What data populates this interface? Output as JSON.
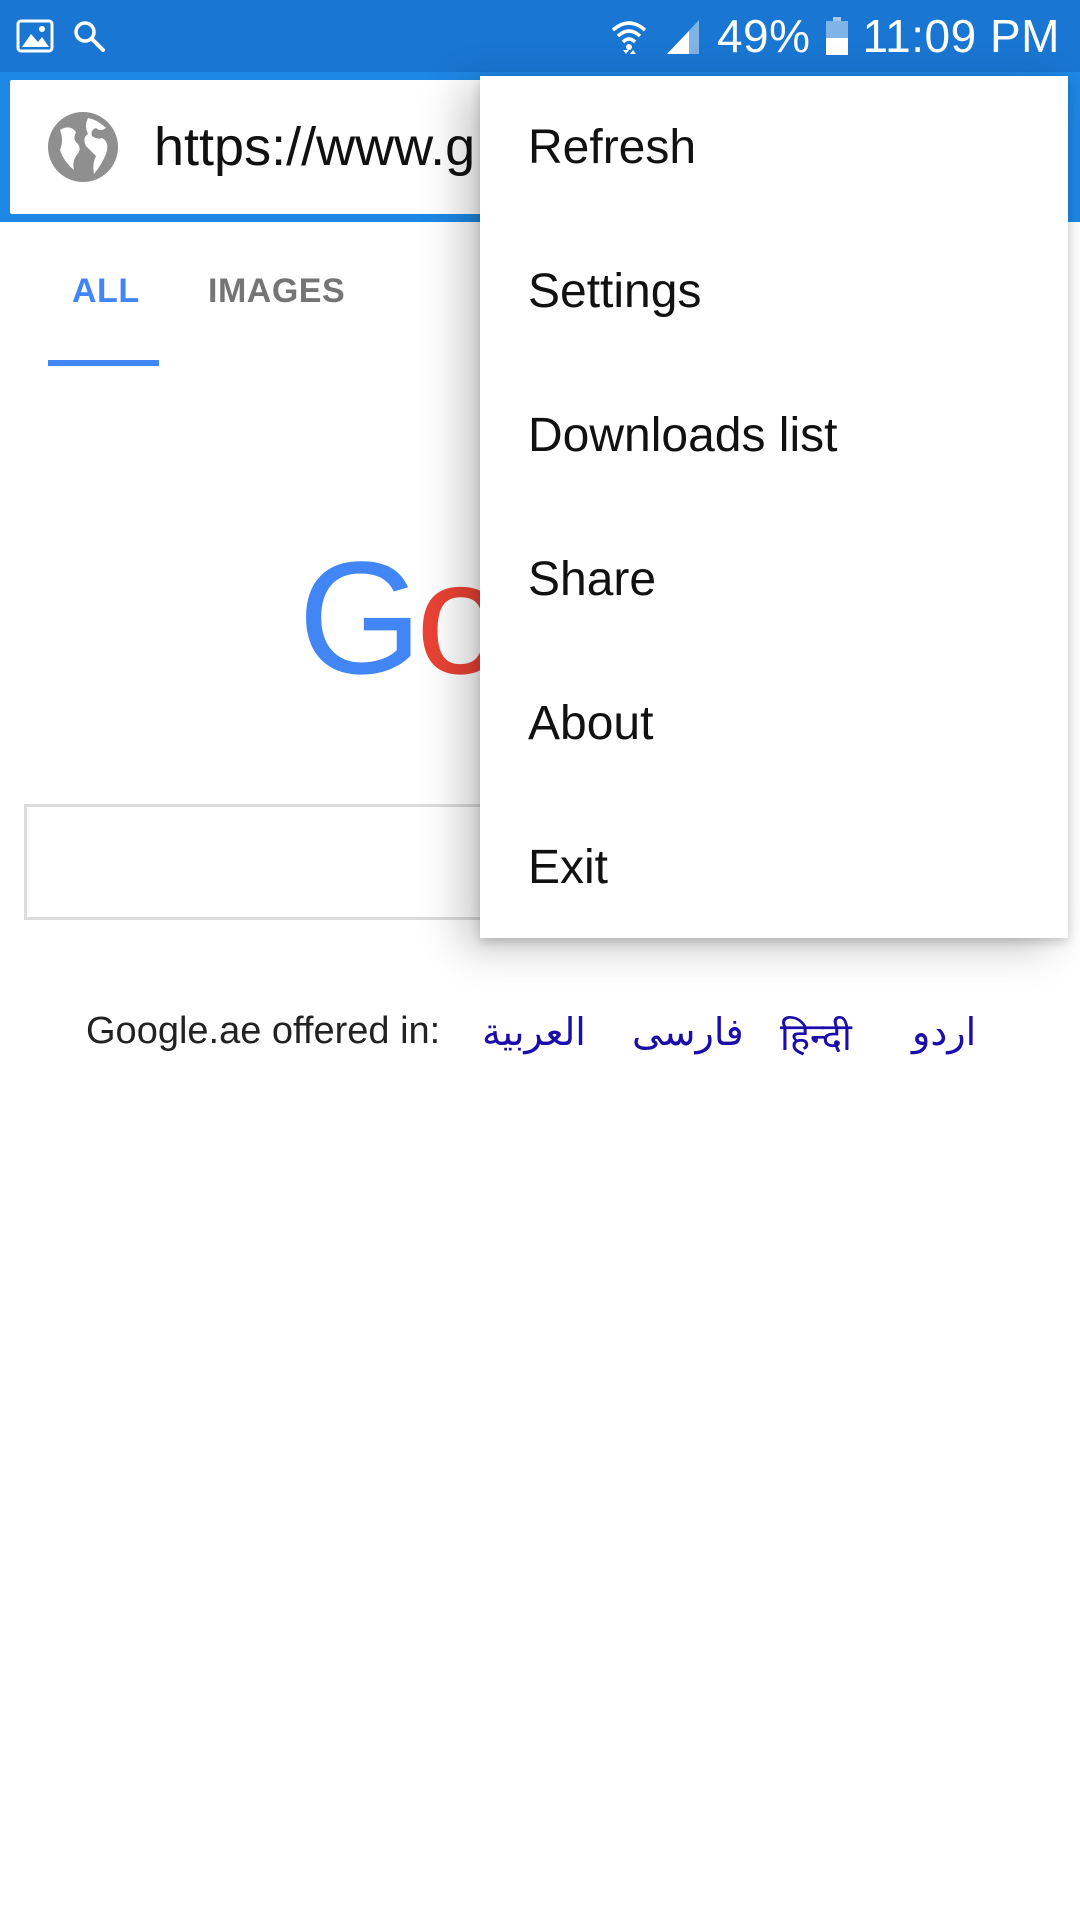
{
  "status_bar": {
    "battery": "49%",
    "time": "11:09 PM"
  },
  "url_bar": {
    "url": "https://www.g"
  },
  "tabs": [
    {
      "label": "ALL",
      "selected": true
    },
    {
      "label": "IMAGES",
      "selected": false
    }
  ],
  "logo": {
    "visible_text": "Go"
  },
  "offered_in": {
    "label": "Google.ae offered in:",
    "languages": [
      "العربية",
      "فارسی",
      "हिन्दी",
      "اردو"
    ]
  },
  "menu": {
    "items": [
      "Refresh",
      "Settings",
      "Downloads list",
      "Share",
      "About",
      "Exit"
    ]
  },
  "colors": {
    "status_bar": "#1976d2",
    "toolbar": "#1e88e5",
    "accent": "#4285f4",
    "link": "#1a0dab"
  }
}
